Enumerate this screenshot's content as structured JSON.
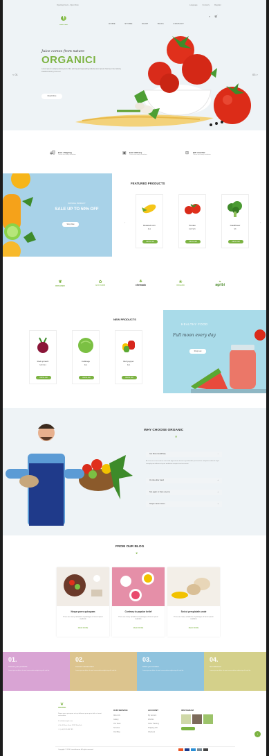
{
  "topbar": {
    "left_text": "Opening hours - Open Now",
    "links": [
      "Language",
      "Currency",
      "Register"
    ]
  },
  "header": {
    "logo_text": "ORGANIC",
    "nav": [
      "HOME",
      "STORE",
      "SHOP",
      "BLOG",
      "CONTACT"
    ]
  },
  "hero": {
    "tagline": "Juice comes from nature",
    "title": "ORGANICI",
    "desc": "Lorem ipsum is simply dummy text of the printing and typesetting industry lorem ipsum has been the industry standard dummy text ever",
    "button": "Read More",
    "prev": "< 01",
    "next": "03 >"
  },
  "features": [
    {
      "title": "Free shipping",
      "sub": "These are many variations"
    },
    {
      "title": "Fast delivery",
      "sub": "These are many variations"
    },
    {
      "title": "Gift voucher",
      "sub": "These are many variations"
    }
  ],
  "sale_banner": {
    "sub": "NATURAL PRODUCT",
    "title": "SALE UP TO 50% OFF",
    "button": "Shop Now"
  },
  "featured": {
    "heading": "FEATURED PRODUCTS",
    "items": [
      {
        "name": "Roasted corn",
        "price": "$12",
        "button": "Add to cart"
      },
      {
        "name": "Tomato",
        "price": "$18  $25",
        "button": "Add to cart"
      },
      {
        "name": "Cauliflower",
        "price": "$8",
        "button": "Add to cart"
      }
    ]
  },
  "brands": [
    "ORGANIC",
    "ECO FARM",
    "chemado",
    "ORGANIC",
    "agribi"
  ],
  "new_products": {
    "heading": "NEW PRODUCTS",
    "items": [
      {
        "name": "Red spinach",
        "price": "$18  $24",
        "button": "Add to cart"
      },
      {
        "name": "Cabbage",
        "price": "$12",
        "button": "Add to cart"
      },
      {
        "name": "Bell pepper",
        "price": "$14",
        "button": "Add to cart"
      }
    ]
  },
  "healthy_banner": {
    "sub": "HEALTHY FOOD",
    "title": "Full moon every day",
    "button": "Shop now"
  },
  "why": {
    "heading": "WHY CHOOSE ORGANIC",
    "accordion": [
      "Get More Healthfully",
      "On the other hand",
      "Not again to there anyone",
      "Neque natum lorem"
    ],
    "open_text": "At vero eos et accusamus iusto odio dignissimos ducimus qui blanditiis praesentium voluptatum deleniti atque corrupti quos dolores et quas molestias excepturi sint occaecati"
  },
  "blog": {
    "heading": "FROM OUR BLOG",
    "posts": [
      {
        "title": "Neque porro quisquam",
        "desc": "There are many variations of passages of lorem ipsum available",
        "more": "READ MORE"
      },
      {
        "title": "Contrary to popular belief",
        "desc": "There are many variations of passages of lorem ipsum available",
        "more": "READ MORE"
      },
      {
        "title": "Sed ut perspiciatis unde",
        "desc": "There are many variations of passages of lorem ipsum available",
        "more": "READ MORE"
      }
    ]
  },
  "steps": [
    {
      "num": "01.",
      "title": "Choose your products",
      "desc": "Lorem ipsum dolor sit amet consectetur adipiscing elit sed do"
    },
    {
      "num": "02.",
      "title": "Connect nearest farm",
      "desc": "Lorem ipsum dolor sit amet consectetur adipiscing elit sed do"
    },
    {
      "num": "03.",
      "title": "Share your location",
      "desc": "Lorem ipsum dolor sit amet consectetur adipiscing elit sed do"
    },
    {
      "num": "04.",
      "title": "Get delivered",
      "desc": "Lorem ipsum dolor sit amet consectetur adipiscing elit sed do"
    }
  ],
  "footer": {
    "about": "Neque porro quisquam est qui dolorem ipsum quia dolor sit amet consectetur",
    "email": "info@example.com",
    "address": "No 40 Baria Sreet 133/2 NewYork",
    "phone": "(+00) 123 456 789",
    "cols": [
      {
        "title": "OUR SERVICE",
        "items": [
          "About Us",
          "Gallery",
          "Our Team",
          "Services",
          "Our Blog"
        ]
      },
      {
        "title": "ACCOUNT",
        "items": [
          "My account",
          "Wishlist",
          "Order Tracking",
          "Shipping Info",
          "Checkout"
        ]
      },
      {
        "title": "INSTAGRAM",
        "items": []
      }
    ],
    "copyright": "Copyright © 2020 Cosmicthemes. All rights reserved"
  },
  "colors": {
    "accent": "#7cb342",
    "step1": "#d9a4d4",
    "step2": "#dcc48e",
    "step3": "#8fc3de",
    "step4": "#d4d08a"
  }
}
